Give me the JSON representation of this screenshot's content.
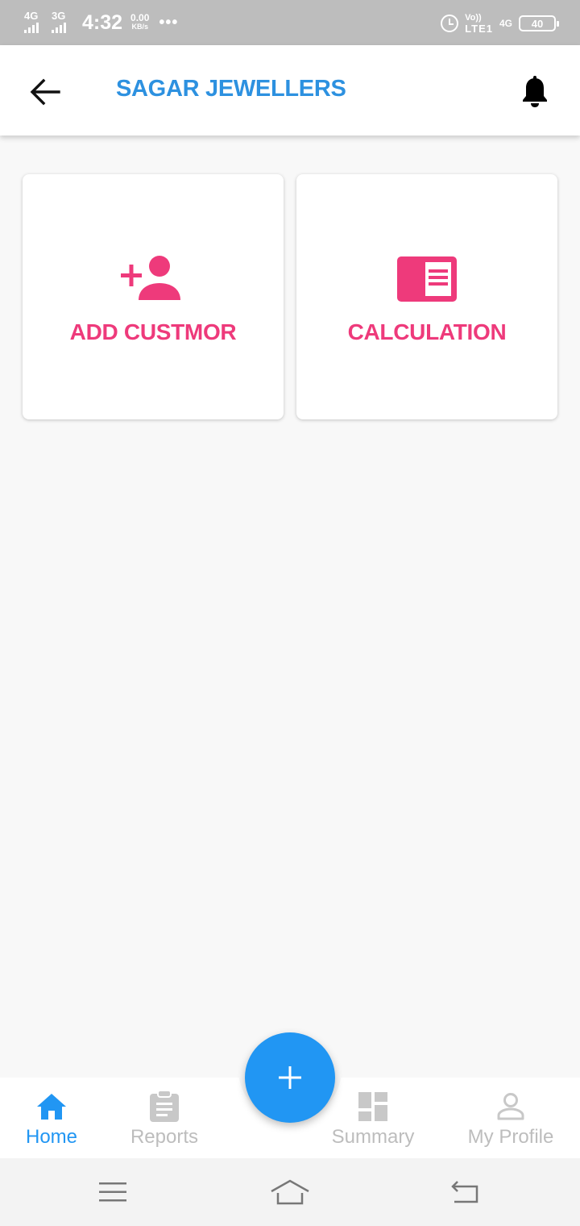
{
  "status_bar": {
    "network1": "4G",
    "network2": "3G",
    "time": "4:32",
    "speed_value": "0.00",
    "speed_unit": "KB/s",
    "more": "•••",
    "volte_top": "Vo))",
    "volte_bottom": "LTE1",
    "network3": "4G",
    "battery": "40"
  },
  "app_bar": {
    "title": "SAGAR JEWELLERS",
    "back_icon": "arrow-back-icon",
    "bell_icon": "bell-icon"
  },
  "cards": {
    "add_customer": {
      "label": "ADD CUSTMOR",
      "icon": "person-add-icon"
    },
    "calculation": {
      "label": "CALCULATION",
      "icon": "chrome-reader-mode-icon"
    }
  },
  "bottom_nav": {
    "items": [
      {
        "label": "Home",
        "icon": "home-icon",
        "active": true
      },
      {
        "label": "Reports",
        "icon": "clipboard-icon",
        "active": false
      },
      {
        "label": "Summary",
        "icon": "dashboard-icon",
        "active": false
      },
      {
        "label": "My Profile",
        "icon": "person-outline-icon",
        "active": false
      }
    ],
    "fab_icon": "plus-icon"
  },
  "colors": {
    "primary_blue": "#2196f3",
    "title_blue": "#2d91e0",
    "accent_pink": "#ee3a7b",
    "inactive_gray": "#bdbdbd",
    "background": "#f8f8f8"
  }
}
